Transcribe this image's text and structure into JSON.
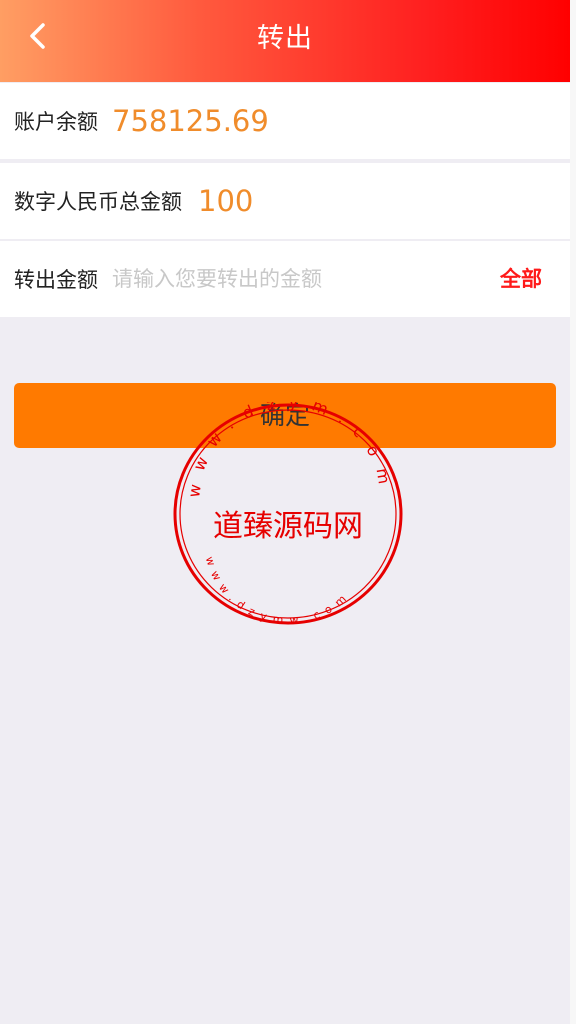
{
  "header": {
    "title": "转出",
    "back_icon": "chevron-left-icon"
  },
  "account": {
    "balance_label": "账户余额",
    "balance_value": "758125.69"
  },
  "digital": {
    "total_label": "数字人民币总金额",
    "total_value": "100"
  },
  "transfer": {
    "amount_label": "转出金额",
    "amount_placeholder": "请输入您要转出的金额",
    "amount_value": "",
    "all_label": "全部"
  },
  "confirm": {
    "label": "确定"
  },
  "watermark": {
    "center_text": "道臻源码网",
    "ring_text": "www.dzym.com",
    "bottom_text": "www.dzymw.com"
  },
  "colors": {
    "header_gradient_start": "#ff9e63",
    "header_gradient_end": "#ff0000",
    "value_orange": "#f08c2b",
    "confirm_orange": "#ff7a00",
    "all_red": "#ff1a1a",
    "seal_red": "#e60000",
    "page_bg": "#efedf3"
  }
}
